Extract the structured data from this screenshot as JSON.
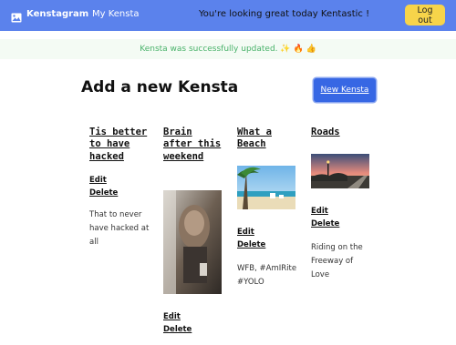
{
  "navbar": {
    "brand": "Kenstagram",
    "my_link": "My Kensta",
    "greeting": "You're looking great today Kentastic !",
    "logout": "Log out"
  },
  "flash": {
    "message": "Kensta was successfully updated. ✨ 🔥 👍"
  },
  "main": {
    "title": "Add a new Kensta",
    "new_button": "New Kensta"
  },
  "posts": [
    {
      "title": "Tis better to have hacked",
      "edit": "Edit",
      "delete": "Delete",
      "caption": "That to never have hacked at all"
    },
    {
      "title": "Brain after this weekend",
      "edit": "Edit",
      "delete": "Delete",
      "caption": ""
    },
    {
      "title": "What a Beach",
      "edit": "Edit",
      "delete": "Delete",
      "caption": "WFB, #AmIRite #YOLO"
    },
    {
      "title": "Roads",
      "edit": "Edit",
      "delete": "Delete",
      "caption": "Riding on the Freeway of Love"
    }
  ],
  "colors": {
    "navbar": "#5b82ec",
    "logout_button": "#f7d44a",
    "flash_text": "#49b26a",
    "primary_button": "#3767e4"
  }
}
